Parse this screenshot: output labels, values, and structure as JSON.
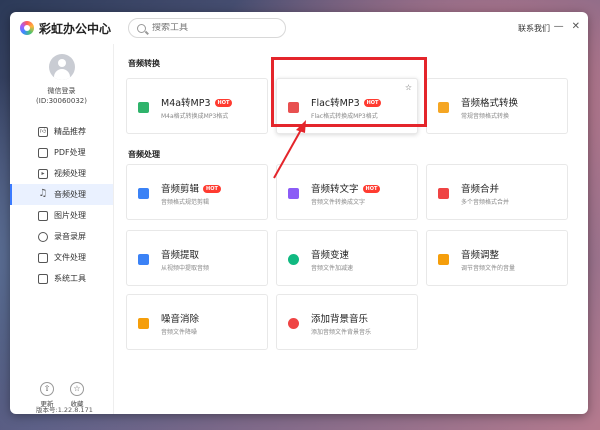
{
  "app": {
    "title": "彩虹办公中心"
  },
  "search": {
    "placeholder": "搜索工具"
  },
  "header": {
    "contact": "联系我们",
    "minimize": "—",
    "close": "✕"
  },
  "user": {
    "login_label": "微信登录",
    "id_label": "(ID:30060032)"
  },
  "sidebar": {
    "items": [
      {
        "label": "精品推荐",
        "icon": "thumb-up-icon",
        "active": false
      },
      {
        "label": "PDF处理",
        "icon": "pdf-icon",
        "active": false
      },
      {
        "label": "视频处理",
        "icon": "video-icon",
        "active": false
      },
      {
        "label": "音频处理",
        "icon": "music-note-icon",
        "active": true
      },
      {
        "label": "图片处理",
        "icon": "image-icon",
        "active": false
      },
      {
        "label": "录音录屏",
        "icon": "record-icon",
        "active": false
      },
      {
        "label": "文件处理",
        "icon": "folder-icon",
        "active": false
      },
      {
        "label": "系统工具",
        "icon": "toolbox-icon",
        "active": false
      }
    ],
    "bottom": [
      {
        "label": "更新",
        "icon": "update-icon"
      },
      {
        "label": "收藏",
        "icon": "star-icon"
      }
    ],
    "version": "版本号:1.22.8.171"
  },
  "sections": [
    {
      "title": "音频转换",
      "cards": [
        {
          "title": "M4a转MP3",
          "hot": "HOT",
          "desc": "M4a格式转换成MP3格式",
          "icon": "m4a-icon",
          "color": "#2fb36b"
        },
        {
          "title": "Flac转MP3",
          "hot": "HOT",
          "desc": "Flac格式转换成MP3格式",
          "icon": "flac-icon",
          "color": "#e85050"
        },
        {
          "title": "音频格式转换",
          "hot": "",
          "desc": "常规音频格式转换",
          "icon": "audio-convert-icon",
          "color": "#f5a623"
        }
      ]
    },
    {
      "title": "音频处理",
      "cards": [
        {
          "title": "音频剪辑",
          "hot": "HOT",
          "desc": "音频格式规范剪辑",
          "icon": "audio-cut-icon",
          "color": "#3b82f6"
        },
        {
          "title": "音频转文字",
          "hot": "HOT",
          "desc": "音频文件转换成文字",
          "icon": "audio-text-icon",
          "color": "#8b5cf6"
        },
        {
          "title": "音频合并",
          "hot": "",
          "desc": "多个音频格式合并",
          "icon": "audio-merge-icon",
          "color": "#ef4444"
        },
        {
          "title": "音频提取",
          "hot": "",
          "desc": "从视频中提取音频",
          "icon": "audio-extract-icon",
          "color": "#3b82f6"
        },
        {
          "title": "音频变速",
          "hot": "",
          "desc": "音频文件加减速",
          "icon": "audio-speed-icon",
          "color": "#10b981"
        },
        {
          "title": "音频调整",
          "hot": "",
          "desc": "调节音频文件的音量",
          "icon": "audio-volume-icon",
          "color": "#f59e0b"
        },
        {
          "title": "噪音消除",
          "hot": "",
          "desc": "音频文件降噪",
          "icon": "noise-remove-icon",
          "color": "#f59e0b"
        },
        {
          "title": "添加背景音乐",
          "hot": "",
          "desc": "添加音频文件背景音乐",
          "icon": "bgm-icon",
          "color": "#ef4444"
        }
      ]
    }
  ]
}
